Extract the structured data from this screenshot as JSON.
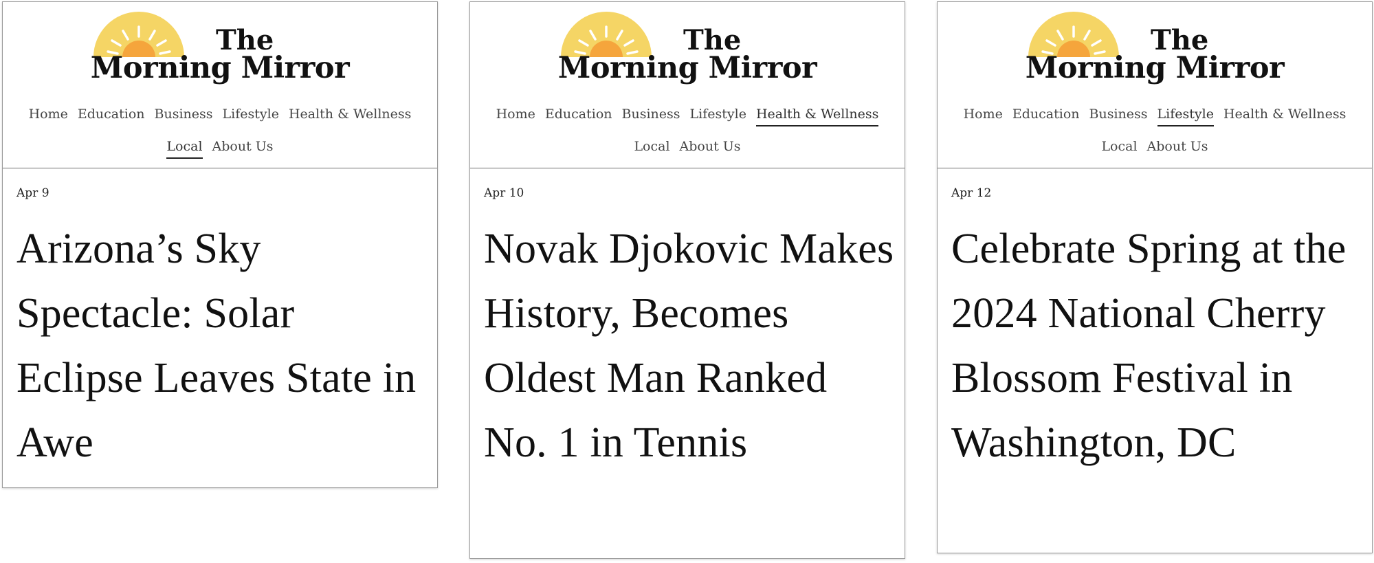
{
  "brand": {
    "title_line1": "The",
    "title_line2": "Morning Mirror",
    "sun_color": "#f5d565",
    "sun_core_color": "#f5a53c"
  },
  "cards": [
    {
      "nav": [
        "Home",
        "Education",
        "Business",
        "Lifestyle",
        "Health & Wellness",
        "Local",
        "About Us"
      ],
      "active_nav": "Local",
      "date": "Apr 9",
      "headline": "Arizona’s Sky Spectacle: Solar Eclipse Leaves State in Awe"
    },
    {
      "nav": [
        "Home",
        "Education",
        "Business",
        "Lifestyle",
        "Health & Wellness",
        "Local",
        "About Us"
      ],
      "active_nav": "Health & Wellness",
      "date": "Apr 10",
      "headline": "Novak Djokovic Makes History, Becomes Oldest Man Ranked No. 1 in Tennis"
    },
    {
      "nav": [
        "Home",
        "Education",
        "Business",
        "Lifestyle",
        "Health & Wellness",
        "Local",
        "About Us"
      ],
      "active_nav": "Lifestyle",
      "date": "Apr 12",
      "headline": "Celebrate Spring at the 2024 National Cherry Blossom Festival in Washington, DC"
    }
  ]
}
